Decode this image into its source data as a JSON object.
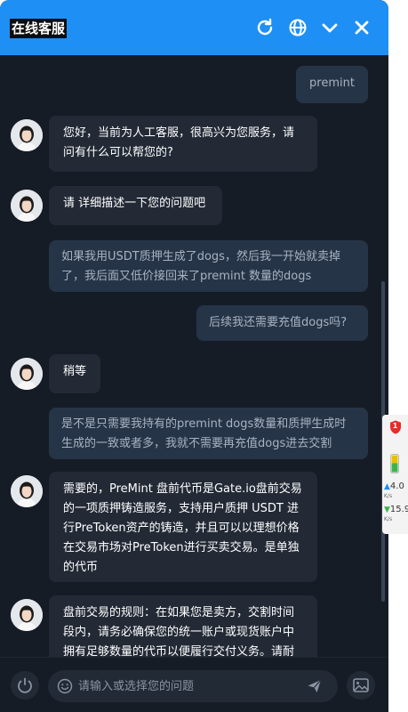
{
  "header": {
    "title": "在线客服",
    "icons": [
      "refresh-icon",
      "globe-icon",
      "chevron-down-icon",
      "close-icon"
    ]
  },
  "messages": [
    {
      "role": "user",
      "text": "premint"
    },
    {
      "role": "agent",
      "text": "您好，当前为人工客服，很高兴为您服务，请问有什么可以帮您的?"
    },
    {
      "role": "agent",
      "text": "请 详细描述一下您的问题吧"
    },
    {
      "role": "user",
      "text": "如果我用USDT质押生成了dogs，然后我一开始就卖掉了，我后面又低价接回来了premint  数量的dogs"
    },
    {
      "role": "user",
      "text": "后续我还需要充值dogs吗?"
    },
    {
      "role": "agent",
      "text": "稍等"
    },
    {
      "role": "user",
      "text": "是不是只需要我持有的premint dogs数量和质押生成时生成的一致或者多，我就不需要再充值dogs进去交割"
    },
    {
      "role": "agent",
      "text": "需要的，PreMint 盘前代币是Gate.io盘前交易的一项质押铸造服务，支持用户质押 USDT 进行PreToken资产的铸造，并且可以以理想价格在交易市场对PreToken进行买卖交易。是单独的代币"
    },
    {
      "role": "agent",
      "text": "盘前交易的规则：在如果您是卖方，交割时间段内，请务必确保您的统一账户或现货账户中拥有足够数量的代币以便履行交付义务。请耐心等待交割完成。"
    }
  ],
  "footer": {
    "input_placeholder": "请输入或选择您的问题",
    "input_value": "",
    "icons": [
      "power-icon",
      "emoji-icon",
      "send-icon",
      "image-icon"
    ]
  },
  "side_widget": {
    "badge": "1",
    "upload_speed": "4.0",
    "upload_unit": "K/s",
    "download_speed": "15.9",
    "download_unit": "K/s"
  },
  "colors": {
    "header_bg": "#1e90f5",
    "chat_bg": "#161c26",
    "agent_bubble": "#232a36",
    "user_bubble": "#263447",
    "user_text": "#a7b3c3"
  }
}
